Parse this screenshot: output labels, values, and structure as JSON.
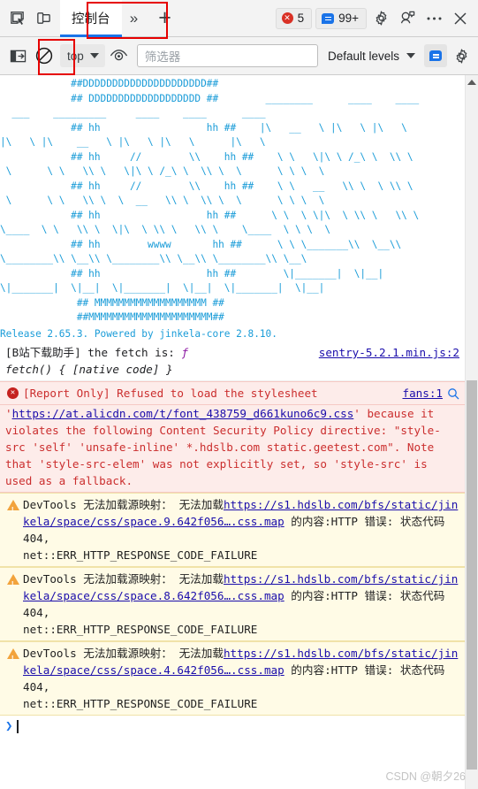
{
  "tabbar": {
    "inspect_icon": "inspect-element-icon",
    "device_icon": "device-toolbar-icon",
    "active_tab": "控制台",
    "more_tabs": "»",
    "add_tab": "+",
    "error_badge": {
      "icon": "error-circle-icon",
      "count": "5"
    },
    "message_badge": {
      "icon": "message-bubble-icon",
      "count": "99+"
    },
    "settings_icon": "gear-icon",
    "feedback_icon": "feedback-icon",
    "more_icon": "kebab-menu-icon",
    "close_icon": "close-icon"
  },
  "console_toolbar": {
    "sidebar_icon": "show-console-sidebar-icon",
    "clear_icon": "clear-console-icon",
    "context": "top",
    "eye_icon": "live-expression-icon",
    "filter_placeholder": "筛选器",
    "filter_value": "",
    "levels_label": "Default levels",
    "issues_icon": "message-filter-icon",
    "settings_icon": "console-settings-icon"
  },
  "annotations": {
    "tab_box_color": "#e60000",
    "clear_box_color": "#e60000"
  },
  "console": {
    "ascii_art": "            ##DDDDDDDDDDDDDDDDDDDDD##\n            ## DDDDDDDDDDDDDDDDDDD ##        ________      ____    ____\n  ___    _________     ____    ____      ____\n            ## hh                  hh ##    |\\   __   \\ |\\   \\ |\\   \\\n|\\   \\ |\\    __   \\ |\\   \\ |\\   \\      |\\   \\\n            ## hh     //        \\\\    hh ##    \\ \\   \\|\\ \\ /_\\ \\  \\\\ \\\n \\      \\ \\   \\\\ \\   \\|\\ \\ /_\\ \\  \\\\ \\  \\      \\ \\ \\  \\\n            ## hh     //        \\\\    hh ##    \\ \\   __   \\\\ \\  \\ \\\\ \\\n \\      \\ \\   \\\\ \\  \\  __   \\\\ \\  \\\\ \\  \\      \\ \\ \\  \\\n            ## hh                  hh ##      \\ \\  \\ \\|\\  \\ \\\\ \\   \\\\ \\\n\\____  \\ \\   \\\\ \\  \\|\\  \\ \\\\ \\   \\\\ \\    \\____  \\ \\ \\  \\\n            ## hh        wwww       hh ##      \\ \\ \\_______\\\\  \\__\\\\\n\\________\\\\ \\__\\\\ \\________\\\\ \\__\\\\ \\________\\\\ \\__\\\n            ## hh                  hh ##        \\|_______|  \\|__|\n\\|_______|  \\|__|  \\|_______|  \\|__|  \\|_______|  \\|__|\n             ## MMMMMMMMMMMMMMMMMMM ##\n             ##MMMMMMMMMMMMMMMMMMMMM##",
    "release_line": "Release 2.65.3. Powered by jinkela-core 2.8.10.",
    "messages": [
      {
        "type": "log",
        "prefix": "[B站下载助手] the fetch is: ",
        "fn_glyph": "ƒ",
        "body": "fetch() { [native code] }",
        "source": "sentry-5.2.1.min.js:2",
        "icon": ""
      },
      {
        "type": "error",
        "icon": "error-circle-icon",
        "text_head": "[Report Only] Refused to load the stylesheet ",
        "link": "https://at.alicdn.com/t/font_438759_d661kuno6c9.css",
        "link_open": "'",
        "text_tail": "' because it violates the following Content Security Policy directive: \"style-src 'self' 'unsafe-inline' *.hdslb.com static.geetest.com\". Note that 'style-src-elem' was not explicitly set, so 'style-src' is used as a fallback.",
        "source": "fans:1",
        "magnifier": "search-icon"
      },
      {
        "type": "warn",
        "icon": "warning-triangle-icon",
        "head": "DevTools 无法加载源映射：  无法加载",
        "link": "https://s1.hdslb.com/bfs/static/jinkela/space/css/space.9.642f056….css.map",
        "mid": " 的内容:HTTP 错误: 状态代码 404,",
        "tail": "net::ERR_HTTP_RESPONSE_CODE_FAILURE"
      },
      {
        "type": "warn",
        "icon": "warning-triangle-icon",
        "head": "DevTools 无法加载源映射：  无法加载",
        "link": "https://s1.hdslb.com/bfs/static/jinkela/space/css/space.8.642f056….css.map",
        "mid": " 的内容:HTTP 错误: 状态代码 404,",
        "tail": "net::ERR_HTTP_RESPONSE_CODE_FAILURE"
      },
      {
        "type": "warn",
        "icon": "warning-triangle-icon",
        "head": "DevTools 无法加载源映射：  无法加载",
        "link": "https://s1.hdslb.com/bfs/static/jinkela/space/css/space.4.642f056….css.map",
        "mid": " 的内容:HTTP 错误: 状态代码 404,",
        "tail": "net::ERR_HTTP_RESPONSE_CODE_FAILURE"
      }
    ],
    "prompt_arrow": "❯"
  },
  "scrollbar": {
    "up_arrow": "scroll-up-arrow-icon"
  },
  "watermark": "CSDN @朝夕26"
}
